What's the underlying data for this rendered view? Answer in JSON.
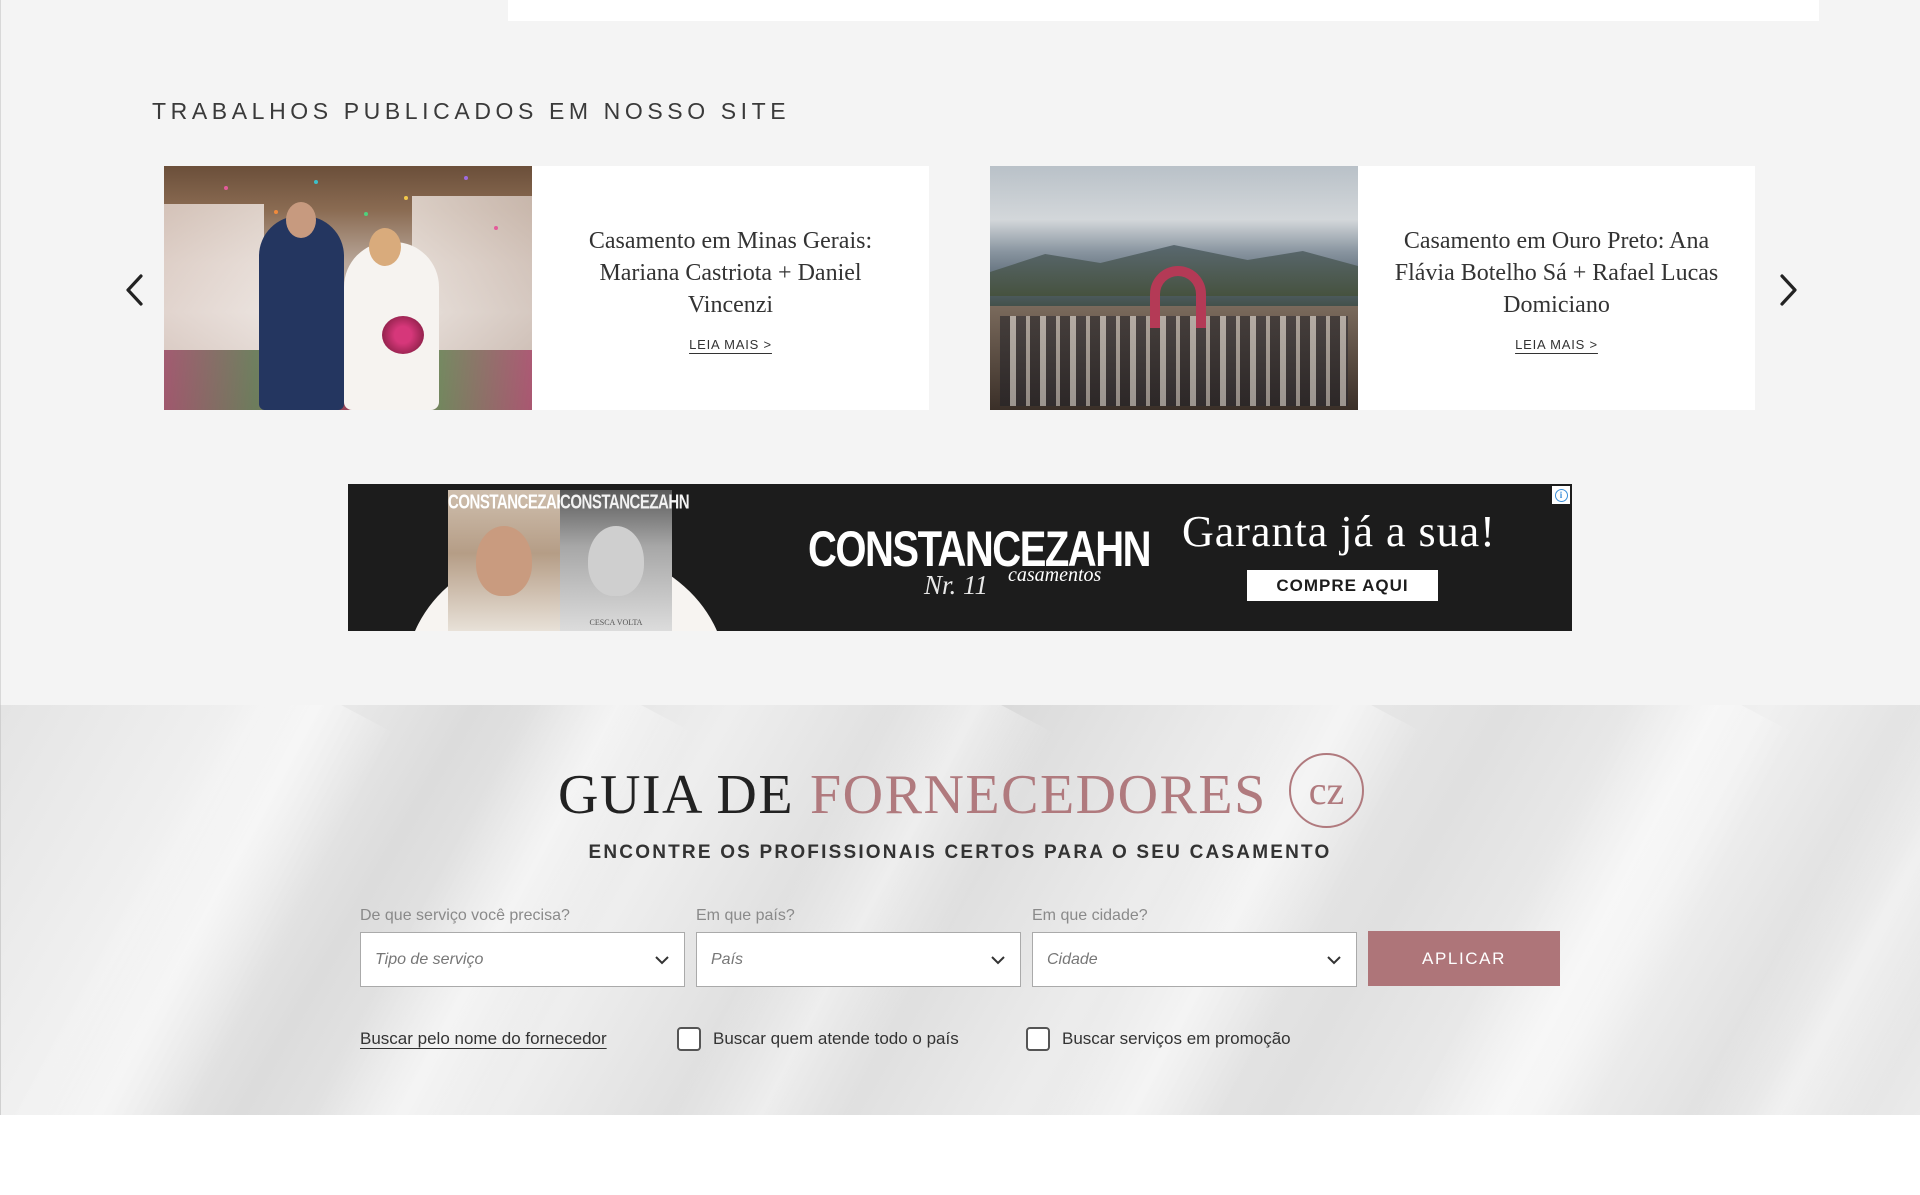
{
  "published": {
    "section_title": "TRABALHOS PUBLICADOS EM NOSSO SITE",
    "cards": [
      {
        "title": "Casamento em Minas Gerais: Mariana Castriota + Daniel Vincenzi",
        "link": "LEIA MAIS >",
        "image": "wedding-couple-confetti-photo"
      },
      {
        "title": "Casamento em Ouro Preto: Ana Flávia Botelho Sá + Rafael Lucas Domiciano",
        "link": "LEIA MAIS >",
        "image": "mountain-ceremony-photo"
      }
    ],
    "prev_icon": "chevron-left-icon",
    "next_icon": "chevron-right-icon"
  },
  "ad": {
    "magazine_brand": "CONSTANCEZAHN",
    "magazine_cover_text": "CESCA VOLTA",
    "brand": "CONSTANCEZAHN",
    "edition": "Nr. 11",
    "script": "casamentos",
    "headline": "Garanta já a sua!",
    "cta": "COMPRE AQUI",
    "info_icon": "info-icon"
  },
  "guide": {
    "title_dark": "GUIA DE",
    "title_accent": "FORNECEDORES",
    "logo": "cz",
    "subtitle": "ENCONTRE OS PROFISSIONAIS CERTOS PARA O SEU CASAMENTO",
    "fields": [
      {
        "label": "De que serviço você precisa?",
        "placeholder": "Tipo de serviço"
      },
      {
        "label": "Em que país?",
        "placeholder": "País"
      },
      {
        "label": "Em que cidade?",
        "placeholder": "Cidade"
      }
    ],
    "apply": "APLICAR",
    "search_by_name": "Buscar pelo nome do fornecedor",
    "option_nationwide": "Buscar quem atende todo o país",
    "option_promo": "Buscar serviços em promoção"
  },
  "colors": {
    "accent": "#ae7579",
    "background": "#f4f4f4",
    "ad_background": "#1c1c1c"
  }
}
